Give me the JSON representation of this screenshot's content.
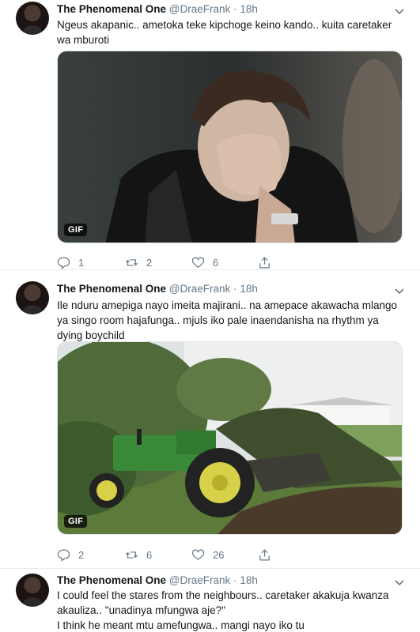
{
  "tweets": [
    {
      "name": "The Phenomenal One",
      "handle": "@DraeFrank",
      "dot": "·",
      "time": "18h",
      "lines": [
        "Ngeus akapanic.. ametoka teke kipchoge keino kando.. kuita caretaker wa mburoti"
      ],
      "media_badge": "GIF",
      "replies": "1",
      "retweets": "2",
      "likes": "6"
    },
    {
      "name": "The Phenomenal One",
      "handle": "@DraeFrank",
      "dot": "·",
      "time": "18h",
      "lines": [
        "Ile nduru amepiga nayo imeita majirani.. na amepace akawacha mlango ya singo room hajafunga.. mjuls iko pale inaendanisha na rhythm ya dying boychild"
      ],
      "media_badge": "GIF",
      "replies": "2",
      "retweets": "6",
      "likes": "26"
    },
    {
      "name": "The Phenomenal One",
      "handle": "@DraeFrank",
      "dot": "·",
      "time": "18h",
      "lines": [
        "I could feel the stares from the neighbours.. caretaker akakuja kwanza akauliza.. \"unadinya mfungwa aje?\"",
        "I think he meant mtu amefungwa.. mangi nayo iko tu"
      ]
    }
  ],
  "icons": {
    "reply": "reply-icon",
    "retweet": "retweet-icon",
    "like": "heart-icon",
    "share": "share-icon",
    "caret": "chevron-down-icon"
  },
  "colors": {
    "text": "#14171a",
    "muted": "#657786",
    "border": "#e6ecf0"
  }
}
